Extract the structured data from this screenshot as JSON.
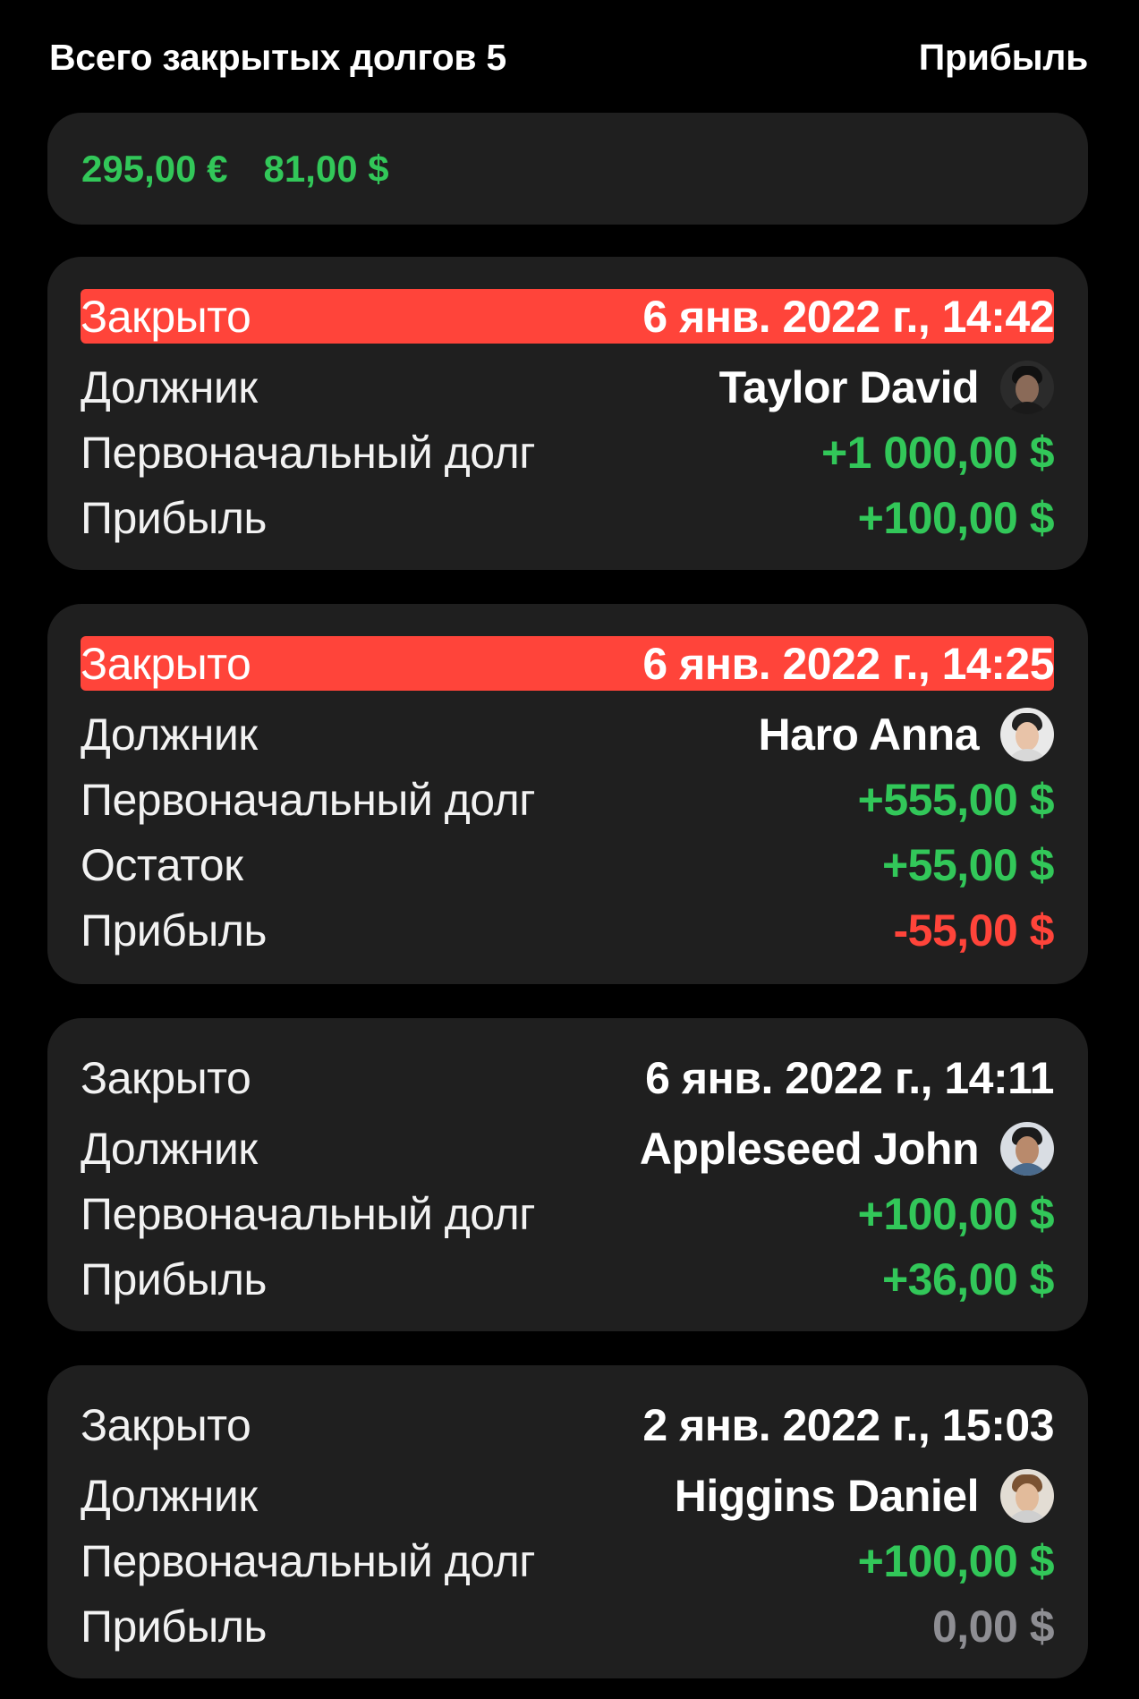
{
  "header": {
    "title": "Всего закрытых долгов 5",
    "right_label": "Прибыль"
  },
  "summary": {
    "amounts": [
      "295,00 €",
      "81,00 $"
    ],
    "color": "#32c759"
  },
  "labels": {
    "closed": "Закрыто",
    "debtor": "Должник",
    "initial_debt": "Первоначальный долг",
    "remainder": "Остаток",
    "profit": "Прибыль"
  },
  "colors": {
    "positive": "#32c759",
    "negative": "#ff443a",
    "neutral": "#8e8e93",
    "highlight": "#ff443a",
    "card_bg": "#1f1f1f"
  },
  "debts": [
    {
      "closed_date": "6 янв. 2022 г., 14:42",
      "highlighted": true,
      "debtor": "Taylor David",
      "avatar_icon": "person-dark-avatar-icon",
      "initial_debt": "+1 000,00 $",
      "profit": "+100,00 $",
      "profit_status": "positive"
    },
    {
      "closed_date": "6 янв. 2022 г., 14:25",
      "highlighted": true,
      "debtor": "Haro Anna",
      "avatar_icon": "person-light-avatar-icon",
      "initial_debt": "+555,00 $",
      "remainder": "+55,00 $",
      "profit": "-55,00 $",
      "profit_status": "negative"
    },
    {
      "closed_date": "6 янв. 2022 г., 14:11",
      "highlighted": false,
      "debtor": "Appleseed John",
      "avatar_icon": "person-bearded-avatar-icon",
      "initial_debt": "+100,00 $",
      "profit": "+36,00 $",
      "profit_status": "positive"
    },
    {
      "closed_date": "2 янв. 2022 г., 15:03",
      "highlighted": false,
      "debtor": "Higgins Daniel",
      "avatar_icon": "person-curly-avatar-icon",
      "initial_debt": "+100,00 $",
      "profit": "0,00 $",
      "profit_status": "neutral"
    }
  ]
}
